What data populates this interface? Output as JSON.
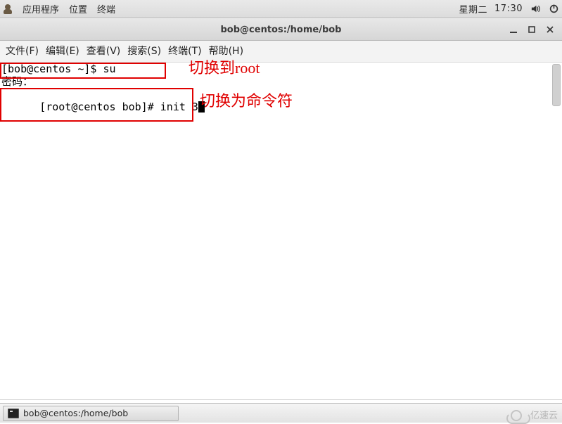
{
  "panel": {
    "applications": "应用程序",
    "places": "位置",
    "terminal_label": "终端",
    "clock_day": "星期二",
    "clock_time": "17:30"
  },
  "window": {
    "title": "bob@centos:/home/bob"
  },
  "menubar": {
    "file": "文件(F)",
    "edit": "编辑(E)",
    "view": "查看(V)",
    "search": "搜索(S)",
    "terminal": "终端(T)",
    "help": "帮助(H)"
  },
  "terminal": {
    "line1": "[bob@centos ~]$ su",
    "line2": "密码：",
    "line3_a": "[root@centos bob]# init 3"
  },
  "annotations": {
    "a1": "切换到root",
    "a2": "切换为命令符"
  },
  "taskbar": {
    "task1": "bob@centos:/home/bob"
  },
  "watermark": {
    "text": "亿速云"
  }
}
